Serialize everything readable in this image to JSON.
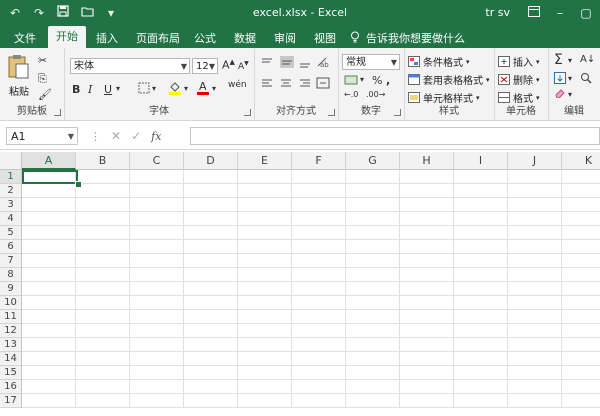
{
  "window": {
    "title": "excel.xlsx  -  Excel",
    "user": "tr sv"
  },
  "tabs": [
    "文件",
    "开始",
    "插入",
    "页面布局",
    "公式",
    "数据",
    "审阅",
    "视图"
  ],
  "active_tab": "开始",
  "tell_me": "告诉我你想要做什么",
  "ribbon": {
    "clipboard": {
      "label": "剪贴板",
      "paste": "粘贴"
    },
    "font": {
      "label": "字体",
      "name": "宋体",
      "size": "12",
      "bold": "B",
      "italic": "I",
      "underline": "U"
    },
    "alignment": {
      "label": "对齐方式"
    },
    "number": {
      "label": "数字",
      "format": "常规",
      "percent": "%"
    },
    "styles": {
      "label": "样式",
      "conditional": "条件格式",
      "table": "套用表格格式",
      "cell_styles": "单元格样式"
    },
    "cells": {
      "label": "单元格",
      "insert": "插入",
      "delete": "删除",
      "format": "格式"
    },
    "editing": {
      "label": "编辑"
    }
  },
  "formula_bar": {
    "name_box": "A1",
    "fx": "fx"
  },
  "columns": [
    "A",
    "B",
    "C",
    "D",
    "E",
    "F",
    "G",
    "H",
    "I",
    "J",
    "K"
  ],
  "rows": [
    "1",
    "2",
    "3",
    "4",
    "5",
    "6",
    "7",
    "8",
    "9",
    "10",
    "11",
    "12",
    "13",
    "14",
    "15",
    "16",
    "17"
  ],
  "colors": {
    "accent": "#217346"
  }
}
